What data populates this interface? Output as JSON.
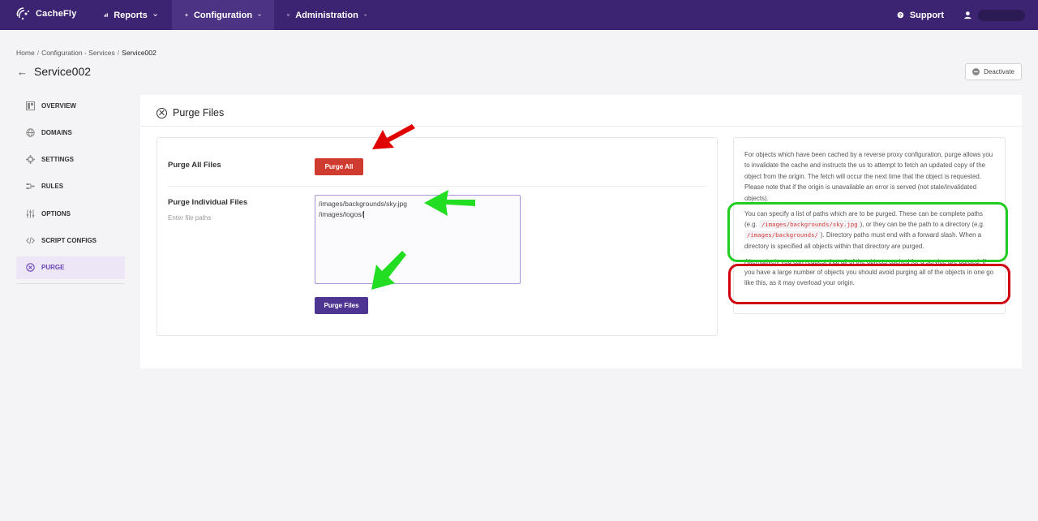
{
  "brand": {
    "name": "CacheFly"
  },
  "nav": {
    "reports": "Reports",
    "configuration": "Configuration",
    "administration": "Administration",
    "support": "Support"
  },
  "breadcrumb": {
    "home": "Home",
    "services": "Configuration - Services",
    "current": "Service002"
  },
  "page": {
    "title": "Service002",
    "deactivate": "Deactivate"
  },
  "sidebar": {
    "items": [
      {
        "label": "OVERVIEW"
      },
      {
        "label": "DOMAINS"
      },
      {
        "label": "SETTINGS"
      },
      {
        "label": "RULES"
      },
      {
        "label": "OPTIONS"
      },
      {
        "label": "SCRIPT CONFIGS"
      },
      {
        "label": "PURGE"
      }
    ]
  },
  "card": {
    "title": "Purge Files",
    "purge_all_label": "Purge All Files",
    "purge_all_button": "Purge All",
    "individual_label": "Purge Individual Files",
    "individual_hint": "Enter file paths",
    "paths": [
      "/images/backgrounds/sky.jpg",
      "/images/logos/"
    ],
    "purge_files_button": "Purge Files"
  },
  "info": {
    "p1": "For objects which have been cached by a reverse proxy configuration, purge allows you to invalidate the cache and instructs the us to attempt to fetch an updated copy of the object from the origin. The fetch will occur the next time that the object is requested. Please note that if the origin is unavailable an error is served (not stale/invalidated objects).",
    "p2a": "You can specify a list of paths which are to be purged. These can be complete paths (e.g.",
    "p2_code1": "/images/backgrounds/sky.jpg",
    "p2b": "), or they can be the path to a directory (e.g.",
    "p2_code2": "/images/backgrounds/",
    "p2c": "). Directory paths must end with a forward slash. When a directory is specified all objects within that directory are purged.",
    "p3": "Alternatively you can request that all of the objects cached for a service are purged. If you have a large number of objects you should avoid purging all of the objects in one go like this, as it may overload your origin."
  },
  "colors": {
    "nav_bg": "#3d2472",
    "accent": "#4f3592",
    "danger": "#d03b30",
    "annotation_green": "#22cc22",
    "annotation_red": "#d00010"
  }
}
